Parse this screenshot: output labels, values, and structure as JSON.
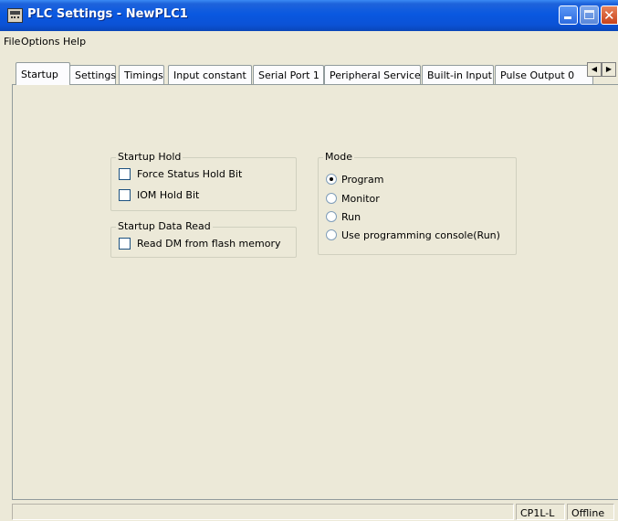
{
  "window": {
    "title": "PLC Settings - NewPLC1"
  },
  "menu": [
    "File",
    "Options",
    "Help"
  ],
  "tabs": [
    {
      "label": "Startup",
      "active": true
    },
    {
      "label": "Settings"
    },
    {
      "label": "Timings"
    },
    {
      "label": "Input constant"
    },
    {
      "label": "Serial Port 1"
    },
    {
      "label": "Peripheral Service"
    },
    {
      "label": "Built-in Input"
    },
    {
      "label": "Pulse Output 0"
    }
  ],
  "startup_hold": {
    "title": "Startup Hold",
    "options": [
      {
        "label": "Force Status Hold Bit",
        "checked": false
      },
      {
        "label": "IOM Hold Bit",
        "checked": false
      }
    ]
  },
  "startup_data_read": {
    "title": "Startup Data Read",
    "options": [
      {
        "label": "Read DM from flash memory",
        "checked": false
      }
    ]
  },
  "mode": {
    "title": "Mode",
    "options": [
      {
        "label": "Program",
        "selected": true
      },
      {
        "label": "Monitor",
        "selected": false
      },
      {
        "label": "Run",
        "selected": false
      },
      {
        "label": "Use programming console(Run)",
        "selected": false
      }
    ]
  },
  "status": {
    "model": "CP1L-L",
    "connection": "Offline"
  }
}
